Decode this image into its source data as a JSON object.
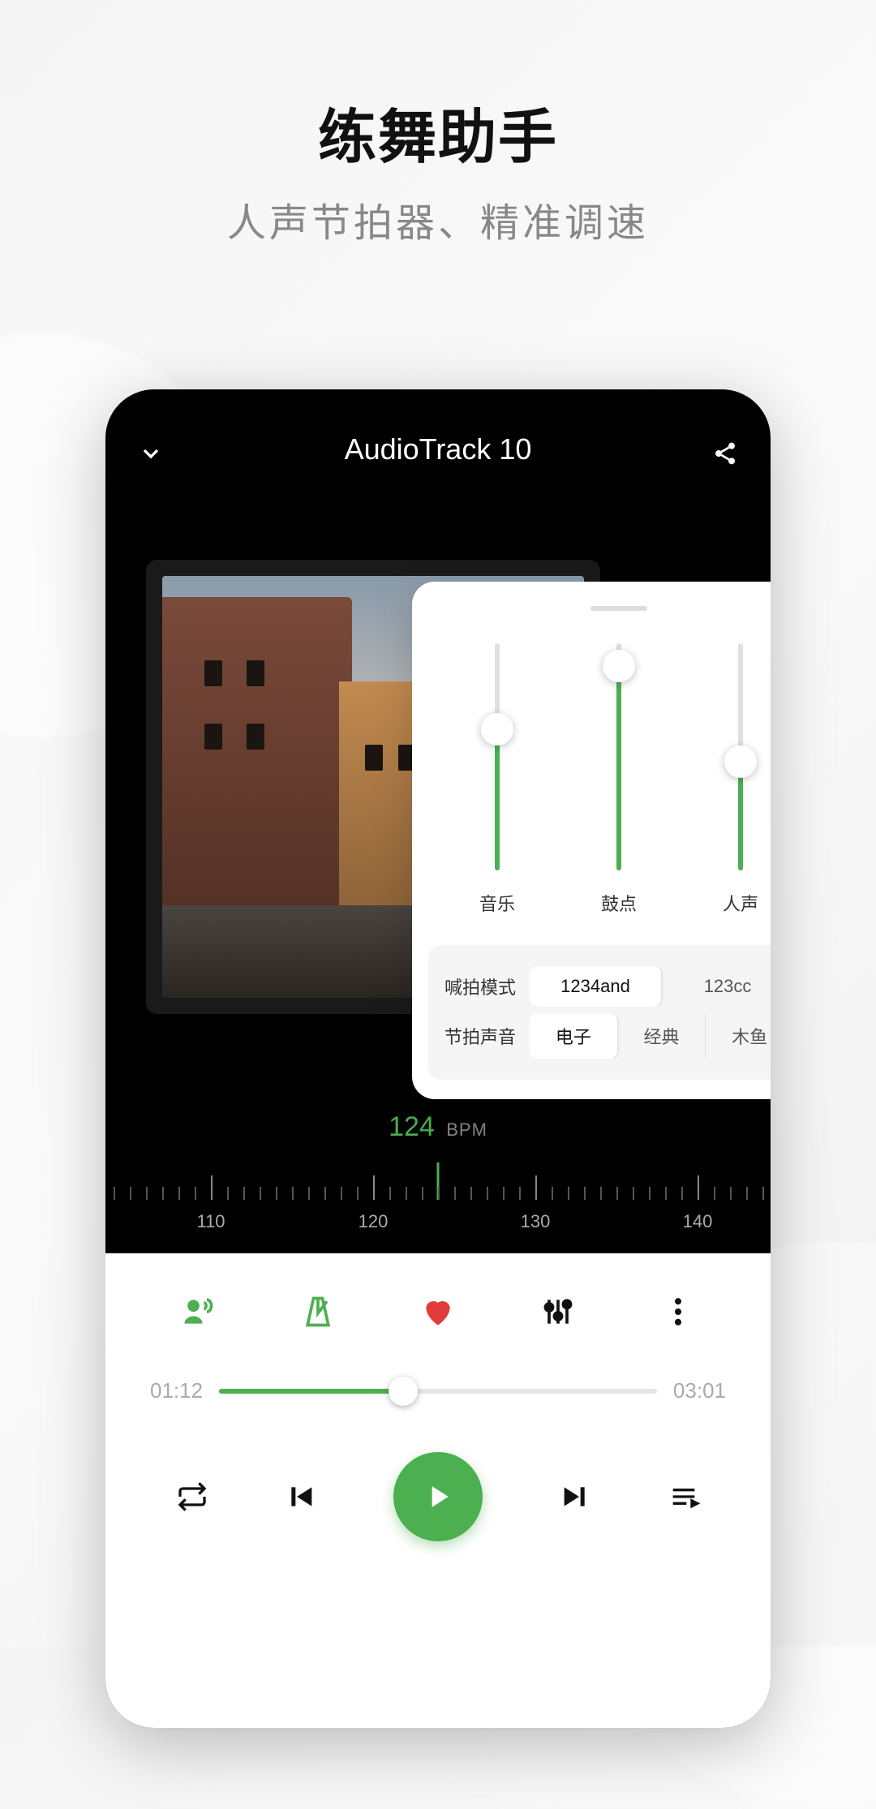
{
  "headline": {
    "title": "练舞助手",
    "subtitle": "人声节拍器、精准调速"
  },
  "player": {
    "track_title": "AudioTrack 10",
    "bpm_value": "124",
    "bpm_unit": "BPM",
    "ruler_labels": [
      "110",
      "120",
      "130",
      "140"
    ],
    "time_elapsed": "01:12",
    "time_total": "03:01",
    "progress_pct": 42
  },
  "settings": {
    "sliders": [
      {
        "label": "音乐",
        "value_pct": 62
      },
      {
        "label": "鼓点",
        "value_pct": 90
      },
      {
        "label": "人声",
        "value_pct": 48
      }
    ],
    "mode_label": "喊拍模式",
    "mode_options": [
      "1234and",
      "123cc"
    ],
    "mode_selected": 0,
    "sound_label": "节拍声音",
    "sound_options": [
      "电子",
      "经典",
      "木鱼"
    ],
    "sound_selected": 0
  },
  "colors": {
    "accent": "#4caf50",
    "heart": "#e23b3b"
  }
}
